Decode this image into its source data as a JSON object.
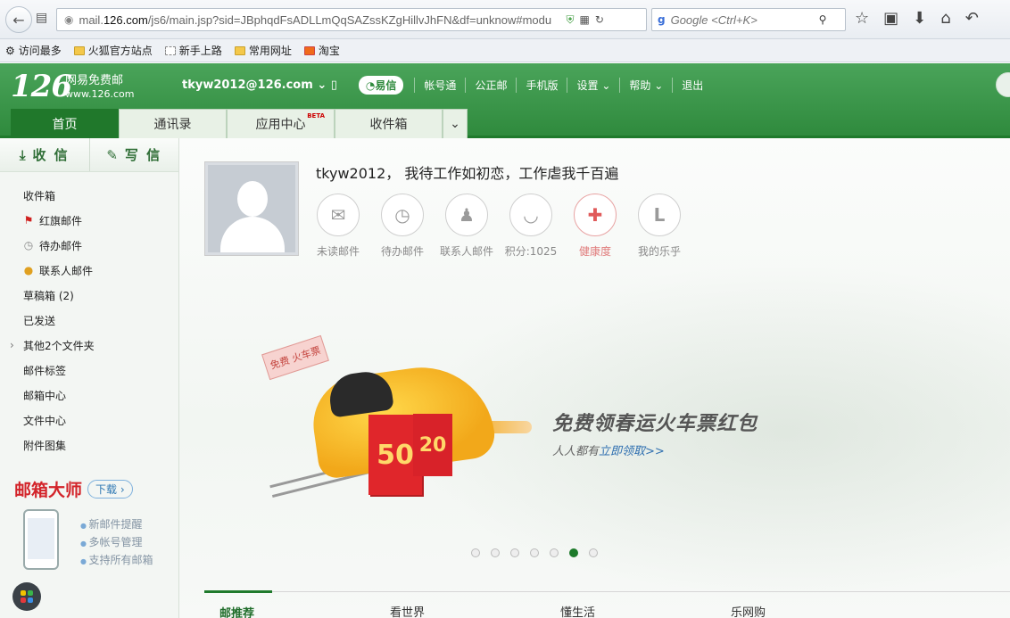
{
  "browser": {
    "url_prefix": "mail.",
    "url_host": "126.com",
    "url_path": "/js6/main.jsp?sid=JBphqdFsADLLmQqSAZssKZgHillvJhFN&df=unknow#modu",
    "search_placeholder": "Google <Ctrl+K>"
  },
  "bookmarks": [
    {
      "label": "访问最多"
    },
    {
      "label": "火狐官方站点"
    },
    {
      "label": "新手上路"
    },
    {
      "label": "常用网址"
    },
    {
      "label": "淘宝"
    }
  ],
  "header": {
    "logo_number": "126",
    "logo_line1": "网易免费邮",
    "logo_line2": "www.126.com",
    "account": "tkyw2012@126.com",
    "yixin": "易信",
    "nav": [
      "帐号通",
      "公正邮",
      "手机版",
      "设置",
      "帮助",
      "退出"
    ]
  },
  "tabs": [
    {
      "label": "首页"
    },
    {
      "label": "通讯录"
    },
    {
      "label": "应用中心",
      "badge": "BETA"
    },
    {
      "label": "收件箱"
    }
  ],
  "sidebar": {
    "receive": "收 信",
    "compose": "写 信",
    "folders": [
      {
        "label": "收件箱",
        "icon": ""
      },
      {
        "label": "红旗邮件",
        "icon": "flag-icon"
      },
      {
        "label": "待办邮件",
        "icon": "clock-icon"
      },
      {
        "label": "联系人邮件",
        "icon": "person-icon"
      },
      {
        "label": "草稿箱 (2)",
        "icon": ""
      },
      {
        "label": "已发送",
        "icon": ""
      },
      {
        "label": "其他2个文件夹",
        "icon": "chevron-right-icon"
      },
      {
        "label": "邮件标签",
        "icon": ""
      },
      {
        "label": "邮箱中心",
        "icon": ""
      },
      {
        "label": "文件中心",
        "icon": ""
      },
      {
        "label": "附件图集",
        "icon": ""
      }
    ],
    "promo": {
      "title": "邮箱大师",
      "download": "下载",
      "features": [
        "新邮件提醒",
        "多帐号管理",
        "支持所有邮箱"
      ]
    }
  },
  "main": {
    "greeting": "tkyw2012， 我待工作如初恋，工作虐我千百遍",
    "stats": [
      {
        "label": "未读邮件",
        "icon": "envelope-icon"
      },
      {
        "label": "待办邮件",
        "icon": "clock-icon"
      },
      {
        "label": "联系人邮件",
        "icon": "contact-star-icon"
      },
      {
        "label": "积分:1025",
        "icon": "coin-icon"
      },
      {
        "label": "健康度",
        "icon": "medkit-icon"
      },
      {
        "label": "我的乐乎",
        "icon": "L-icon"
      }
    ],
    "banner": {
      "ticket_text": "免费 火车票",
      "pack1": "50",
      "pack2": "20",
      "headline": "免费领春运火车票红包",
      "sub_prefix": "人人都有",
      "sub_link": "立即领取>>"
    },
    "carousel": {
      "count": 7,
      "active_index": 5
    },
    "subtabs": [
      "邮推荐",
      "看世界",
      "懂生活",
      "乐网购"
    ]
  },
  "colors": {
    "brand_green": "#2f8a3d",
    "active_tab": "#20782b",
    "accent_red": "#d3242a"
  }
}
